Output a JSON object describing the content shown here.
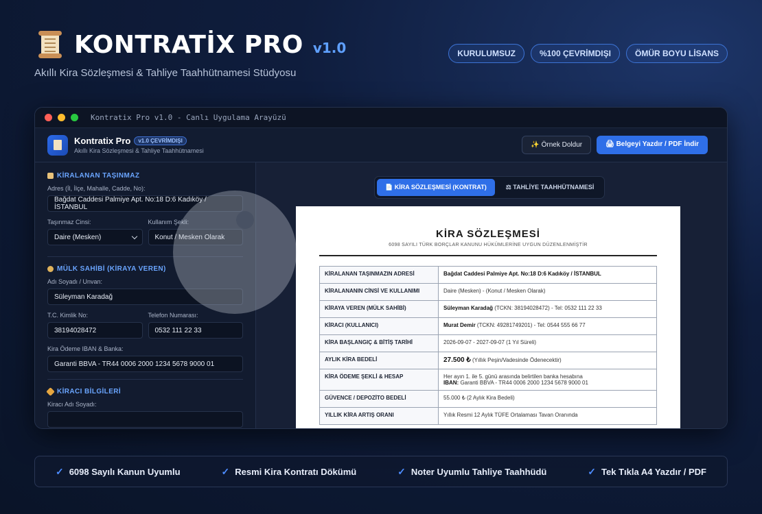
{
  "hero": {
    "brand": "KONTRATİX PRO",
    "version": "v1.0",
    "tagline": "Akıllı Kira Sözleşmesi & Tahliye Taahhütnamesi Stüdyosu",
    "badges": [
      "KURULUMSUZ",
      "%100 ÇEVRİMDIŞI",
      "ÖMÜR BOYU LİSANS"
    ]
  },
  "window": {
    "title": "Kontratix Pro v1.0 - Canlı Uygulama Arayüzü"
  },
  "app": {
    "name": "Kontratix Pro",
    "version_badge": "v1.0 ÇEVRİMDIŞI",
    "subtitle": "Akıllı Kira Sözleşmesi & Tahliye Taahhütnamesi",
    "sample_button": "✨ Örnek Doldur",
    "print_button": "🖨 Belgeyi Yazdır / PDF İndir"
  },
  "sidebar": {
    "property": {
      "title": "KİRALANAN TAŞINMAZ",
      "address_label": "Adres (İl, İlçe, Mahalle, Cadde, No):",
      "address_value": "Bağdat Caddesi Palmiye Apt. No:18 D:6 Kadıköy / İSTANBUL",
      "type_label": "Taşınmaz Cinsi:",
      "type_value": "Daire (Mesken)",
      "usage_label": "Kullanım Şekli:",
      "usage_value": "Konut / Mesken Olarak"
    },
    "owner": {
      "title": "MÜLK SAHİBİ (KİRAYA VEREN)",
      "name_label": "Adı Soyadı / Unvan:",
      "name_value": "Süleyman Karadağ",
      "tc_label": "T.C. Kimlik No:",
      "tc_value": "38194028472",
      "phone_label": "Telefon Numarası:",
      "phone_value": "0532 111 22 33",
      "iban_label": "Kira Ödeme IBAN & Banka:",
      "iban_value": "Garanti BBVA - TR44 0006 2000 1234 5678 9000 01"
    },
    "tenant": {
      "title": "KİRACI BİLGİLERİ",
      "name_label": "Kiracı Adı Soyadı:"
    }
  },
  "tabs": [
    "📄 KİRA SÖZLEŞMESİ (KONTRAT)",
    "⚖ TAHLİYE TAAHHÜTNAMESİ"
  ],
  "document": {
    "title": "KİRA SÖZLEŞMESİ",
    "subtitle": "6098 SAYILI TÜRK BORÇLAR KANUNU HÜKÜMLERİNE UYGUN DÜZENLENMİŞTİR",
    "rows": [
      {
        "key": "KİRALANAN TAŞINMAZIN ADRESİ",
        "value_bold": "Bağdat Caddesi Palmiye Apt. No:18 D:6 Kadıköy / İSTANBUL",
        "value": ""
      },
      {
        "key": "KİRALANANIN CİNSİ VE KULLANIMI",
        "value_bold": "",
        "value": "Daire (Mesken) - (Konut / Mesken Olarak)"
      },
      {
        "key": "KİRAYA VEREN (MÜLK SAHİBİ)",
        "value_bold": "Süleyman Karadağ",
        "value": " (TCKN: 38194028472) - Tel: 0532 111 22 33"
      },
      {
        "key": "KİRACI (KULLANICI)",
        "value_bold": "Murat Demir",
        "value": " (TCKN: 49281749201) - Tel: 0544 555 66 77"
      },
      {
        "key": "KİRA BAŞLANGIÇ & BİTİŞ TARİHİ",
        "value_bold": "",
        "value": "2026-09-07 - 2027-09-07 (1 Yıl Süreli)"
      },
      {
        "key": "AYLIK KİRA BEDELİ",
        "value_bold": "27.500 ₺",
        "value": " (Yıllık Peşin/Vadesinde Ödenecektir)"
      },
      {
        "key": "KİRA ÖDEME ŞEKLİ & HESAP",
        "value_bold": "",
        "value": "Her ayın 1. ile 5. günü arasında belirtilen banka hesabına",
        "line2_bold": "IBAN:",
        "line2": " Garanti BBVA - TR44 0006 2000 1234 5678 9000 01"
      },
      {
        "key": "GÜVENCE / DEPOZİTO BEDELİ",
        "value_bold": "",
        "value": "55.000 ₺ (2 Aylık Kira Bedeli)"
      },
      {
        "key": "YILLIK KİRA ARTIŞ ORANI",
        "value_bold": "",
        "value": "Yıllık Resmi 12 Aylık TÜFE Ortalaması Tavan Oranında"
      }
    ]
  },
  "footer": {
    "features": [
      "6098 Sayılı Kanun Uyumlu",
      "Resmi Kira Kontratı Dökümü",
      "Noter Uyumlu Tahliye Taahhüdü",
      "Tek Tıkla A4 Yazdır / PDF"
    ]
  },
  "colors": {
    "accent": "#2f6fe8",
    "section_title": "#6aa5ff",
    "background": "#0f1d3d"
  }
}
